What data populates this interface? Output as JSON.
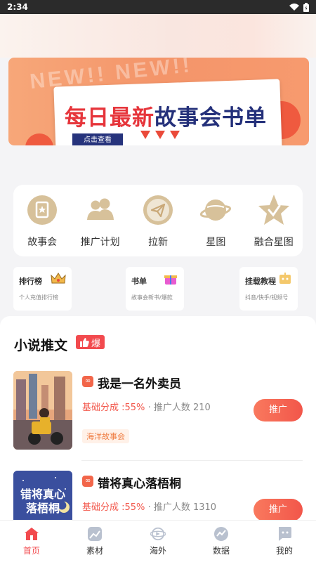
{
  "status_bar": {
    "time": "2:34"
  },
  "banner": {
    "ghost_text": "NEW!! NEW!!",
    "title_red": "每日最新",
    "title_blue": "故事会书单",
    "button": "点击查看"
  },
  "quick_nav": [
    {
      "label": "故事会",
      "icon": "story-book-icon"
    },
    {
      "label": "推广计划",
      "icon": "people-icon"
    },
    {
      "label": "拉新",
      "icon": "paper-plane-icon"
    },
    {
      "label": "星图",
      "icon": "planet-icon"
    },
    {
      "label": "融合星图",
      "icon": "star-icon"
    }
  ],
  "mini_cards": [
    {
      "title": "排行榜",
      "subtitle": "个人充值排行榜",
      "icon": "crown-icon"
    },
    {
      "title": "书单",
      "subtitle": "故事会新书/爆款",
      "icon": "gift-icon"
    },
    {
      "title": "挂载教程",
      "subtitle": "抖音/快手/视频号",
      "icon": "tutorial-icon"
    }
  ],
  "section": {
    "title": "小说推文",
    "badge": "爆"
  },
  "books": [
    {
      "title": "我是一名外卖员",
      "share_label": "基础分成 :55%",
      "promoters": "· 推广人数 210",
      "chip": "海洋故事会",
      "button": "推广"
    },
    {
      "title": "错将真心落梧桐",
      "share_label": "基础分成 :55%",
      "promoters": "· 推广人数 1310",
      "cover_text": "错将真心落梧桐",
      "button": "推广"
    }
  ],
  "tabs": [
    {
      "label": "首页",
      "icon": "home-icon",
      "active": true
    },
    {
      "label": "素材",
      "icon": "image-icon",
      "active": false
    },
    {
      "label": "海外",
      "icon": "globe-plane-icon",
      "active": false
    },
    {
      "label": "数据",
      "icon": "chart-icon",
      "active": false
    },
    {
      "label": "我的",
      "icon": "chat-face-icon",
      "active": false
    }
  ],
  "colors": {
    "accent": "#f24a4e",
    "gold": "#c9a877",
    "banner_blue": "#24307a"
  }
}
